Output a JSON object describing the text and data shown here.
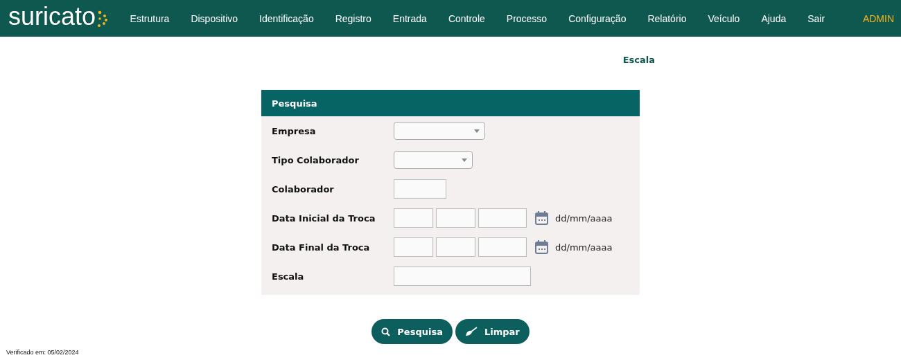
{
  "header": {
    "logo": "suricato",
    "menu": [
      "Estrutura",
      "Dispositivo",
      "Identificação",
      "Registro",
      "Entrada",
      "Controle",
      "Processo",
      "Configuração",
      "Relatório",
      "Veículo",
      "Ajuda",
      "Sair"
    ],
    "user": "ADMIN"
  },
  "page_title": "Escala",
  "panel": {
    "title": "Pesquisa",
    "fields": [
      {
        "label": "Empresa",
        "kind": "select"
      },
      {
        "label": "Tipo Colaborador",
        "kind": "select"
      },
      {
        "label": "Colaborador",
        "kind": "text"
      },
      {
        "label": "Data Inicial da Troca",
        "kind": "date",
        "hint": "dd/mm/aaaa"
      },
      {
        "label": "Data Final da Troca",
        "kind": "date",
        "hint": "dd/mm/aaaa"
      },
      {
        "label": "Escala",
        "kind": "text"
      }
    ]
  },
  "buttons": [
    {
      "label": "Pesquisa",
      "kind": "search"
    },
    {
      "label": "Limpar",
      "kind": "clear"
    }
  ],
  "footer": "Verificado em: 05/02/2024"
}
